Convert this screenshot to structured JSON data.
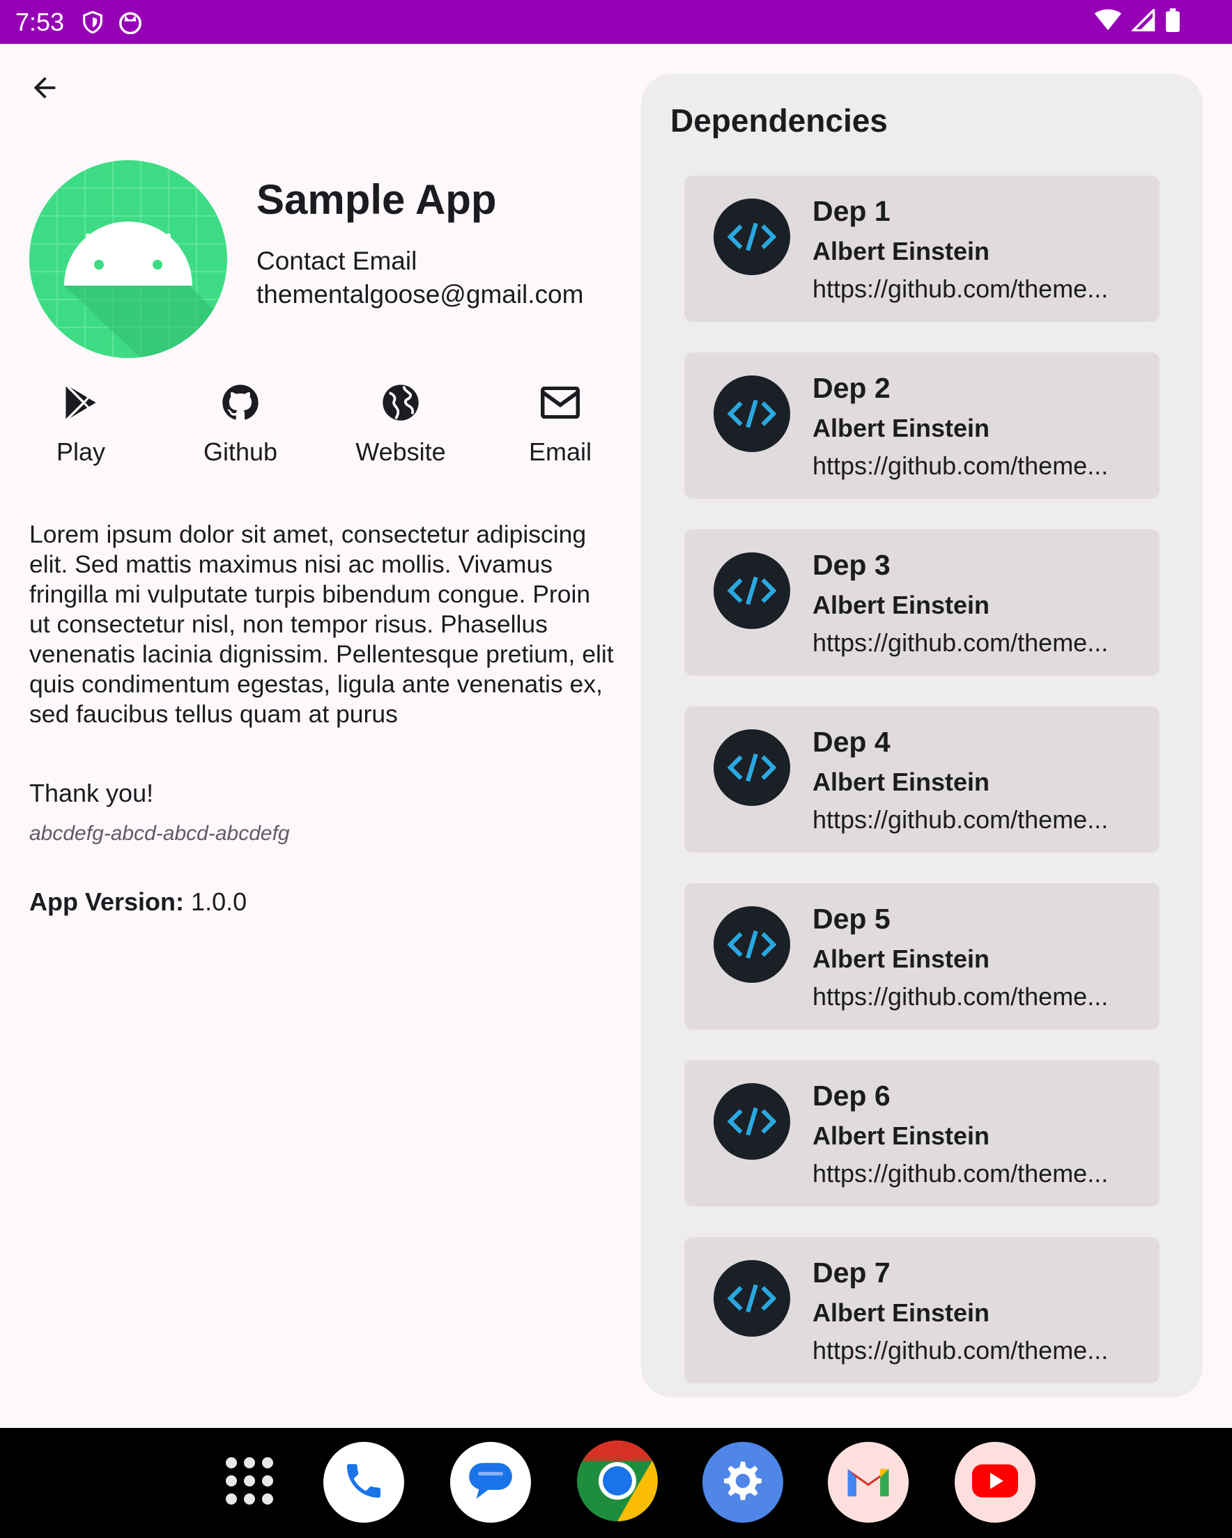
{
  "status_bar": {
    "time": "7:53",
    "left_icons": [
      "shield-icon",
      "cat-icon"
    ],
    "right_icons": [
      "wifi-icon",
      "signal-icon",
      "battery-icon"
    ],
    "background": "#9600b5"
  },
  "app": {
    "title": "Sample App",
    "contact_label": "Contact Email",
    "contact_email": "thementalgoose@gmail.com",
    "logo_color": "#3ddc84",
    "links": [
      {
        "label": "Play",
        "icon": "play-store-icon"
      },
      {
        "label": "Github",
        "icon": "github-icon"
      },
      {
        "label": "Website",
        "icon": "globe-icon"
      },
      {
        "label": "Email",
        "icon": "email-icon"
      }
    ],
    "description": "Lorem ipsum dolor sit amet, consectetur adipiscing elit. Sed mattis maximus nisi ac mollis. Vivamus fringilla mi vulputate turpis bibendum congue. Proin ut consectetur nisl, non tempor risus. Phasellus venenatis lacinia dignissim. Pellentesque pretium, elit quis condimentum egestas, ligula ante venenatis ex, sed faucibus tellus quam at purus",
    "thanks": "Thank you!",
    "token": "abcdefg-abcd-abcd-abcdefg",
    "version_label": "App Version:",
    "version_value": "1.0.0"
  },
  "dependencies": {
    "title": "Dependencies",
    "items": [
      {
        "name": "Dep 1",
        "author": "Albert Einstein",
        "url": "https://github.com/theme..."
      },
      {
        "name": "Dep 2",
        "author": "Albert Einstein",
        "url": "https://github.com/theme..."
      },
      {
        "name": "Dep 3",
        "author": "Albert Einstein",
        "url": "https://github.com/theme..."
      },
      {
        "name": "Dep 4",
        "author": "Albert Einstein",
        "url": "https://github.com/theme..."
      },
      {
        "name": "Dep 5",
        "author": "Albert Einstein",
        "url": "https://github.com/theme..."
      },
      {
        "name": "Dep 6",
        "author": "Albert Einstein",
        "url": "https://github.com/theme..."
      },
      {
        "name": "Dep 7",
        "author": "Albert Einstein",
        "url": "https://github.com/theme..."
      }
    ]
  },
  "dock": {
    "apps": [
      "app-drawer-icon",
      "phone-icon",
      "messages-icon",
      "chrome-icon",
      "settings-icon",
      "gmail-icon",
      "youtube-icon"
    ]
  }
}
